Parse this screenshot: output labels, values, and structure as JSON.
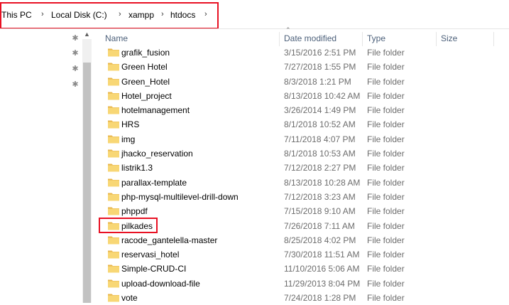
{
  "breadcrumb": {
    "items": [
      "This PC",
      "Local Disk (C:)",
      "xampp",
      "htdocs"
    ],
    "separator": "›"
  },
  "columns": {
    "name": "Name",
    "date_modified": "Date modified",
    "type": "Type",
    "size": "Size"
  },
  "files": [
    {
      "name": "grafik_fusion",
      "date": "3/15/2016 2:51 PM",
      "type": "File folder"
    },
    {
      "name": "Green Hotel",
      "date": "7/27/2018 1:55 PM",
      "type": "File folder"
    },
    {
      "name": "Green_Hotel",
      "date": "8/3/2018 1:21 PM",
      "type": "File folder"
    },
    {
      "name": "Hotel_project",
      "date": "8/13/2018 10:42 AM",
      "type": "File folder"
    },
    {
      "name": "hotelmanagement",
      "date": "3/26/2014 1:49 PM",
      "type": "File folder"
    },
    {
      "name": "HRS",
      "date": "8/1/2018 10:52 AM",
      "type": "File folder"
    },
    {
      "name": "img",
      "date": "7/11/2018 4:07 PM",
      "type": "File folder"
    },
    {
      "name": "jhacko_reservation",
      "date": "8/1/2018 10:53 AM",
      "type": "File folder"
    },
    {
      "name": "listrik1.3",
      "date": "7/12/2018 2:27 PM",
      "type": "File folder"
    },
    {
      "name": "parallax-template",
      "date": "8/13/2018 10:28 AM",
      "type": "File folder"
    },
    {
      "name": "php-mysql-multilevel-drill-down",
      "date": "7/12/2018 3:23 AM",
      "type": "File folder"
    },
    {
      "name": "phppdf",
      "date": "7/15/2018 9:10 AM",
      "type": "File folder"
    },
    {
      "name": "pilkades",
      "date": "7/26/2018 7:11 AM",
      "type": "File folder"
    },
    {
      "name": "racode_gantelella-master",
      "date": "8/25/2018 4:02 PM",
      "type": "File folder"
    },
    {
      "name": "reservasi_hotel",
      "date": "7/30/2018 11:51 AM",
      "type": "File folder"
    },
    {
      "name": "Simple-CRUD-CI",
      "date": "11/10/2016 5:06 AM",
      "type": "File folder"
    },
    {
      "name": "upload-download-file",
      "date": "11/29/2013 8:04 PM",
      "type": "File folder"
    },
    {
      "name": "vote",
      "date": "7/24/2018 1:28 PM",
      "type": "File folder"
    }
  ],
  "colors": {
    "highlight": "#e81123",
    "folder": "#f8d775",
    "folder_dark": "#e8b64c",
    "header_text": "#4c607a"
  }
}
